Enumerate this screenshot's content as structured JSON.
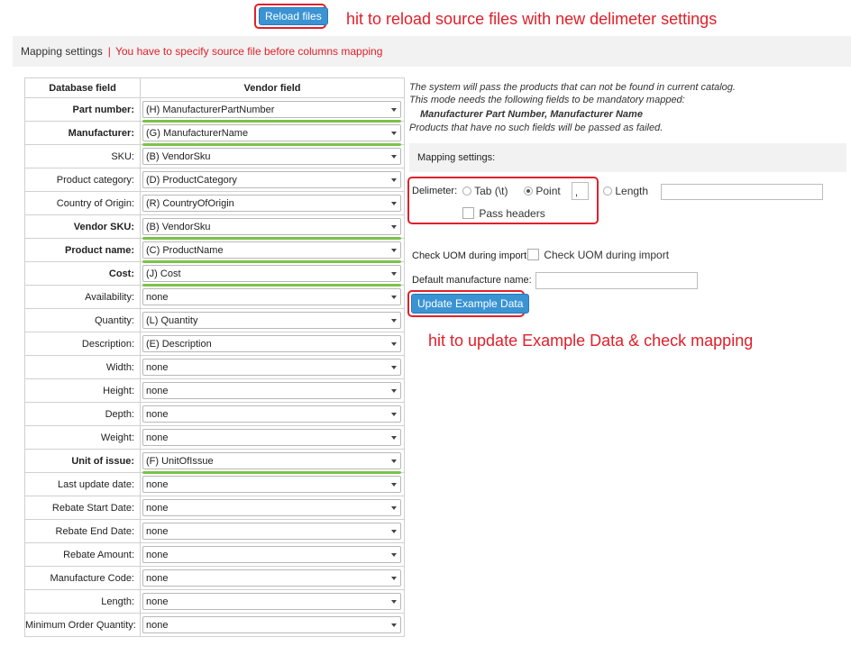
{
  "reload_button": "Reload files",
  "reload_annotation": "hit to reload source files with new delimeter settings",
  "mapping_bar": {
    "title": "Mapping settings",
    "separator": "|",
    "warning": "You have to specify source file before columns mapping"
  },
  "table": {
    "headers": [
      "Database field",
      "Vendor field"
    ],
    "rows": [
      {
        "label": "Part number:",
        "value": "(H) ManufacturerPartNumber",
        "bold": true,
        "mandatory": true
      },
      {
        "label": "Manufacturer:",
        "value": "(G) ManufacturerName",
        "bold": true,
        "mandatory": true
      },
      {
        "label": "SKU:",
        "value": "(B) VendorSku",
        "bold": false,
        "mandatory": false
      },
      {
        "label": "Product category:",
        "value": "(D) ProductCategory",
        "bold": false,
        "mandatory": false
      },
      {
        "label": "Country of Origin:",
        "value": "(R) CountryOfOrigin",
        "bold": false,
        "mandatory": false
      },
      {
        "label": "Vendor SKU:",
        "value": "(B) VendorSku",
        "bold": true,
        "mandatory": true
      },
      {
        "label": "Product name:",
        "value": "(C) ProductName",
        "bold": true,
        "mandatory": true
      },
      {
        "label": "Cost:",
        "value": "(J) Cost",
        "bold": true,
        "mandatory": true
      },
      {
        "label": "Availability:",
        "value": "none",
        "bold": false,
        "mandatory": false
      },
      {
        "label": "Quantity:",
        "value": "(L) Quantity",
        "bold": false,
        "mandatory": false
      },
      {
        "label": "Description:",
        "value": "(E) Description",
        "bold": false,
        "mandatory": false
      },
      {
        "label": "Width:",
        "value": "none",
        "bold": false,
        "mandatory": false
      },
      {
        "label": "Height:",
        "value": "none",
        "bold": false,
        "mandatory": false
      },
      {
        "label": "Depth:",
        "value": "none",
        "bold": false,
        "mandatory": false
      },
      {
        "label": "Weight:",
        "value": "none",
        "bold": false,
        "mandatory": false
      },
      {
        "label": "Unit of issue:",
        "value": "(F) UnitOfIssue",
        "bold": true,
        "mandatory": true
      },
      {
        "label": "Last update date:",
        "value": "none",
        "bold": false,
        "mandatory": false
      },
      {
        "label": "Rebate Start Date:",
        "value": "none",
        "bold": false,
        "mandatory": false
      },
      {
        "label": "Rebate End Date:",
        "value": "none",
        "bold": false,
        "mandatory": false
      },
      {
        "label": "Rebate Amount:",
        "value": "none",
        "bold": false,
        "mandatory": false
      },
      {
        "label": "Manufacture Code:",
        "value": "none",
        "bold": false,
        "mandatory": false
      },
      {
        "label": "Length:",
        "value": "none",
        "bold": false,
        "mandatory": false
      },
      {
        "label": "Minimum Order Quantity:",
        "value": "none",
        "bold": false,
        "mandatory": false
      }
    ]
  },
  "info": {
    "line1": "The system will pass the products that can not be found in current catalog.",
    "line2": "This mode needs the following fields to be mandatory mapped:",
    "line3": "Manufacturer Part Number, Manufacturer Name",
    "line4": "Products that have no such fields will be passed as failed."
  },
  "settings_header": "Mapping settings:",
  "delimeter": {
    "label": "Delimeter:",
    "options": [
      "Tab (\\t)",
      "Point",
      "Length"
    ],
    "selected": "Point",
    "point_value": ",",
    "length_value": "",
    "pass_headers_label": "Pass headers",
    "pass_headers_checked": false
  },
  "uom": {
    "label": "Check UOM during import:",
    "checkbox_label": "Check UOM during import",
    "checked": false
  },
  "default_manufacturer": {
    "label": "Default manufacture name:",
    "value": ""
  },
  "update_button": "Update Example Data",
  "update_annotation": "hit to update Example Data & check mapping",
  "colors": {
    "accent": "#3a93d3",
    "annotation_red": "#e0202a",
    "mandatory_green": "#7cc24a",
    "bar_bg": "#f2f2f2"
  }
}
